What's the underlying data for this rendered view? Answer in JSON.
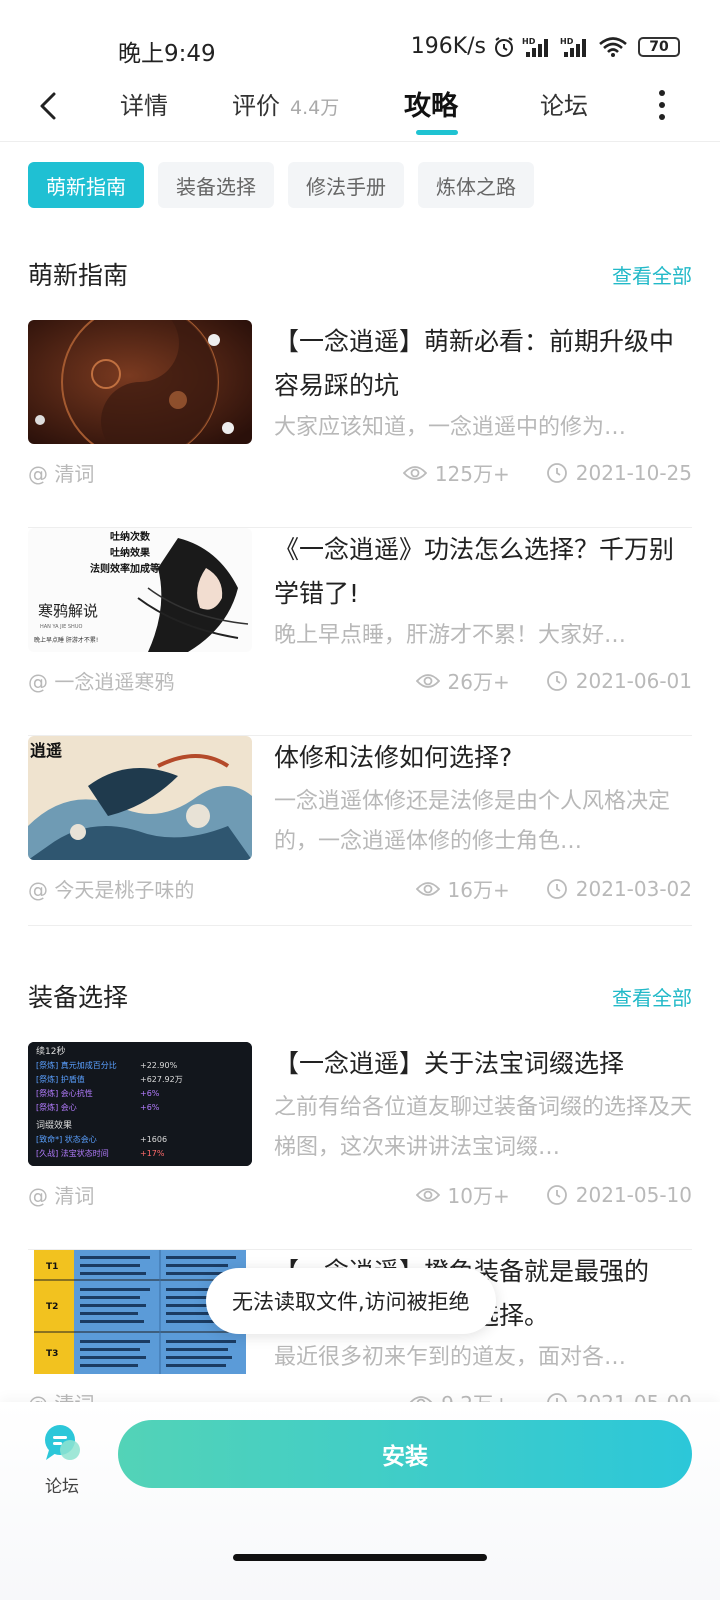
{
  "status": {
    "time": "晚上9:49",
    "speed": "196K/s",
    "battery": "70",
    "icons": [
      "alarm-icon",
      "signal-hd-icon",
      "signal-hd-icon",
      "wifi-icon",
      "battery-icon"
    ]
  },
  "nav": {
    "tabs": [
      {
        "label": "详情",
        "sub": ""
      },
      {
        "label": "评价",
        "sub": "4.4万"
      },
      {
        "label": "攻略",
        "sub": ""
      },
      {
        "label": "论坛",
        "sub": ""
      }
    ],
    "active_tab": "攻略"
  },
  "chips": [
    "萌新指南",
    "装备选择",
    "修法手册",
    "炼体之路"
  ],
  "sections": [
    {
      "title": "萌新指南",
      "see_all": "查看全部",
      "articles": [
        {
          "title": "【一念逍遥】萌新必看：前期升级中容易踩的坑",
          "excerpt": "大家应该知道，一念逍遥中的修为…",
          "author": "@ 清词",
          "views": "125万+",
          "date": "2021-10-25"
        },
        {
          "title": "《一念逍遥》功法怎么选择？千万别学错了!",
          "excerpt": "晚上早点睡，肝游才不累！大家好…",
          "author": "@ 一念逍遥寒鸦",
          "views": "26万+",
          "date": "2021-06-01",
          "thumb_text": {
            "line1": "吐纳次数",
            "line2": "吐纳效果",
            "line3": "法则效率加成等",
            "brand": "寒鸦解说",
            "brand_sub": "HAN YA JIE SHUO",
            "slogan": "晚上早点睡 肝游才不累!"
          }
        },
        {
          "title": "体修和法修如何选择?",
          "excerpt": "一念逍遥体修还是法修是由个人风格决定的，一念逍遥体修的修士角色…",
          "author": "@ 今天是桃子味的",
          "views": "16万+",
          "date": "2021-03-02",
          "thumb_text": {
            "logo": "逍遥"
          }
        }
      ]
    },
    {
      "title": "装备选择",
      "see_all": "查看全部",
      "articles": [
        {
          "title": "【一念逍遥】关于法宝词缀选择",
          "excerpt": "之前有给各位道友聊过装备词缀的选择及天梯图，这次来讲讲法宝词缀…",
          "author": "@ 清词",
          "views": "10万+",
          "date": "2021-05-10",
          "thumb_text": {
            "header": "续12秒",
            "rows": [
              {
                "k": "[祭炼] 真元加成百分比",
                "v": "+22.90%"
              },
              {
                "k": "[祭炼] 护盾值",
                "v": "+627.92万"
              },
              {
                "k": "[祭炼] 会心抗性",
                "v": "+6%"
              },
              {
                "k": "[祭炼] 会心",
                "v": "+6%"
              }
            ],
            "sub_header": "词缀效果",
            "rows2": [
              {
                "k": "[致命*] 状态会心",
                "v": "+1606"
              },
              {
                "k": "[久战] 法宝状态时间",
                "v": "+17%"
              }
            ]
          }
        },
        {
          "title": "【一念逍遥】橙色装备就是最强的吗？关于装备词缀选择。",
          "excerpt": "最近很多初来乍到的道友，面对各…",
          "author": "@ 清词",
          "views": "9.2万+",
          "date": "2021-05-09",
          "thumb_text": {
            "tiers": [
              "T1",
              "T2",
              "T3"
            ]
          }
        }
      ]
    }
  ],
  "toast": "无法读取文件,访问被拒绝",
  "bottom": {
    "forum_label": "论坛",
    "install_label": "安装"
  },
  "colors": {
    "accent": "#1fc0d3",
    "install_gradient_start": "#53d3b7",
    "install_gradient_end": "#2cc7d9"
  }
}
